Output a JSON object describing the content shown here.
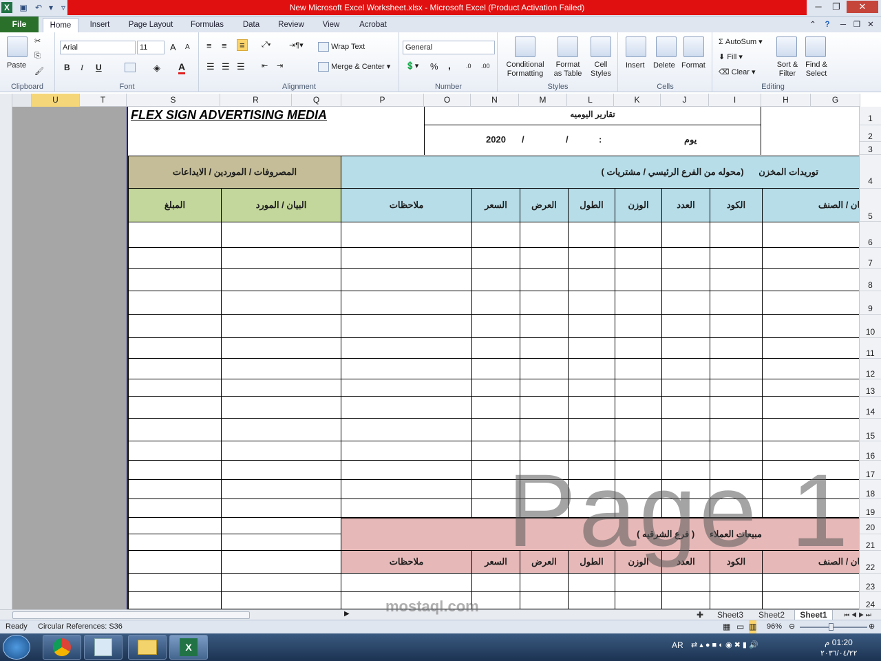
{
  "window": {
    "title": "New Microsoft Excel Worksheet.xlsx  -  Microsoft Excel (Product Activation Failed)",
    "app_icon": "excel-icon"
  },
  "ribbon_tabs": [
    "File",
    "Home",
    "Insert",
    "Page Layout",
    "Formulas",
    "Data",
    "Review",
    "View",
    "Acrobat"
  ],
  "ribbon": {
    "clipboard": {
      "paste": "Paste",
      "label": "Clipboard"
    },
    "font": {
      "name": "Arial",
      "size": "11",
      "label": "Font",
      "bold": "B",
      "italic": "I",
      "underline": "U",
      "grow": "A",
      "shrink": "A",
      "color": "A"
    },
    "alignment": {
      "wrap": "Wrap Text",
      "merge": "Merge & Center",
      "label": "Alignment"
    },
    "number": {
      "format": "General",
      "percent": "%",
      "comma": ",",
      "label": "Number",
      "dec_inc": ".0",
      "dec_dec": ".00"
    },
    "styles": {
      "cond1": "Conditional",
      "cond2": "Formatting",
      "fmt1": "Format",
      "fmt2": "as Table",
      "cell1": "Cell",
      "cell2": "Styles",
      "label": "Styles"
    },
    "cells": {
      "insert": "Insert",
      "delete": "Delete",
      "format": "Format",
      "label": "Cells"
    },
    "editing": {
      "autosum": "AutoSum",
      "fill": "Fill",
      "clear": "Clear",
      "sort1": "Sort &",
      "sort2": "Filter",
      "find1": "Find &",
      "find2": "Select",
      "label": "Editing"
    }
  },
  "columns": [
    "U",
    "T",
    "S",
    "R",
    "Q",
    "P",
    "O",
    "N",
    "M",
    "L",
    "K",
    "J",
    "I",
    "H",
    "G"
  ],
  "rows": [
    "1",
    "2",
    "3",
    "4",
    "5",
    "6",
    "7",
    "8",
    "9",
    "10",
    "11",
    "12",
    "13",
    "14",
    "15",
    "16",
    "17",
    "18",
    "19",
    "20",
    "21",
    "22",
    "23",
    "24"
  ],
  "sheet": {
    "company": "FLEX SIGN ADVERTISING MEDIA",
    "report_title": "تقارير اليوميه",
    "day_label": "يوم",
    "date_colon": ":",
    "date_slash1": "/",
    "date_slash2": "/",
    "year": "2020",
    "supplies_title": "توريدات المخزن",
    "supplies_sub": "(محوله من الفرع الرئيسي / مشتريات )",
    "expenses_title": "المصروفات / الموردين / الايداعات",
    "cols_right": [
      "بيان / الصنف",
      "الكود",
      "العدد",
      "الوزن",
      "الطول",
      "العرض",
      "السعر",
      "ملاحظات"
    ],
    "cols_left": [
      "البيان / المورد",
      "المبلغ"
    ],
    "sales_title": "مبيعات العملاء",
    "sales_sub": "( فرع الشرقيه )",
    "watermark": "Page 1"
  },
  "sheet_tabs": [
    "Sheet3",
    "Sheet2",
    "Sheet1"
  ],
  "status": {
    "ready": "Ready",
    "circ": "Circular References: S36",
    "zoom": "96%"
  },
  "taskbar": {
    "lang": "AR",
    "time": "01:20 م",
    "date": "٢٠٣٦/٠٤/٢٢"
  },
  "overlay": {
    "brand": "mostaql.com"
  }
}
